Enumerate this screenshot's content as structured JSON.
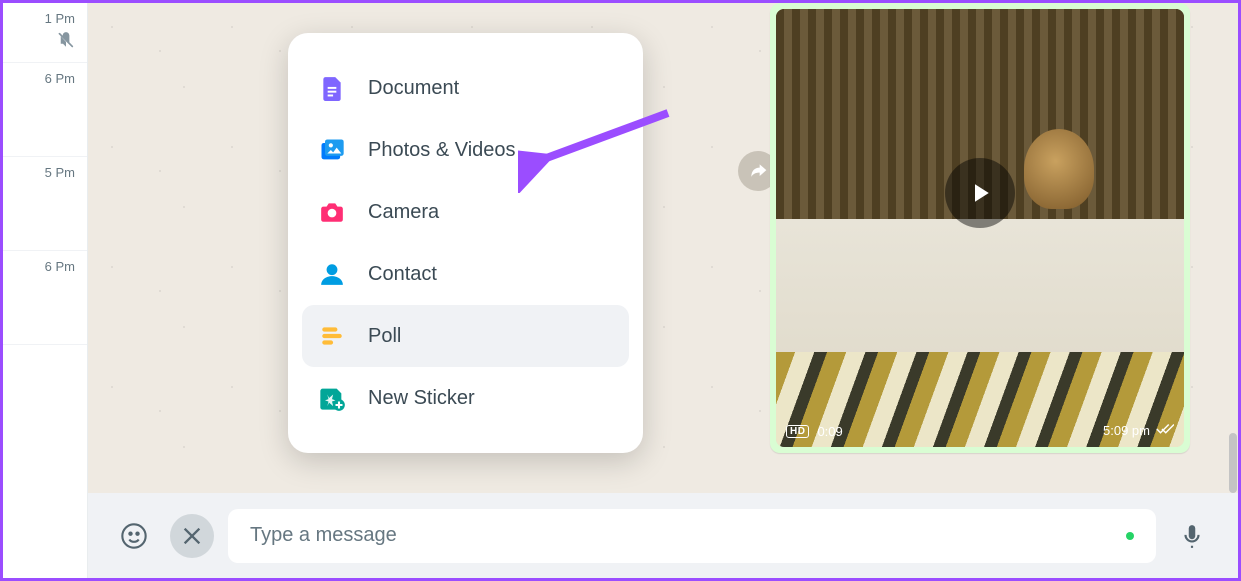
{
  "sidebar": {
    "times": [
      "1 Pm",
      "6 Pm",
      "5 Pm",
      "6 Pm"
    ]
  },
  "menu": {
    "items": [
      {
        "label": "Document",
        "icon": "document"
      },
      {
        "label": "Photos & Videos",
        "icon": "photos"
      },
      {
        "label": "Camera",
        "icon": "camera"
      },
      {
        "label": "Contact",
        "icon": "contact"
      },
      {
        "label": "Poll",
        "icon": "poll"
      },
      {
        "label": "New Sticker",
        "icon": "sticker"
      }
    ],
    "highlighted_index": 4,
    "pointed_index": 1
  },
  "video": {
    "hd": "HD",
    "duration": "0:09",
    "sent": "5:09 pm"
  },
  "composer": {
    "placeholder": "Type a message"
  }
}
